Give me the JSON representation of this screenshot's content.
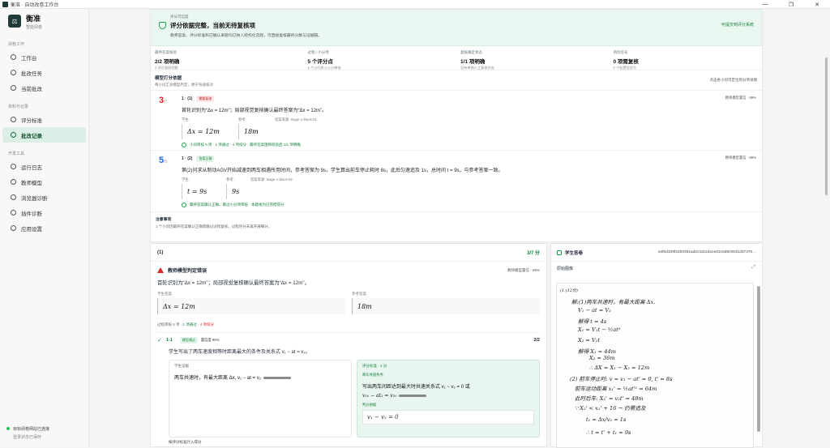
{
  "window": {
    "title": "衡准 · 自动改卷工作台",
    "min": "—",
    "max": "❐",
    "close": "✕"
  },
  "sidebar": {
    "brand_name": "衡准",
    "brand_sub": "智能阅卷",
    "groups": [
      {
        "label": "阅卷工作",
        "items": [
          "工作台",
          "批改任务",
          "当前批改"
        ]
      },
      {
        "label": "资料与记录",
        "items": [
          "评分标准",
          "批改记录"
        ]
      },
      {
        "label": "开发工具",
        "items": [
          "运行日志",
          "教师模型",
          "浏览器诊断",
          "插件诊断",
          "应用设置"
        ]
      }
    ],
    "active_item": "批改记录",
    "footer_status": "目标阅卷网站已连接",
    "footer_sub": "登录状态已保存"
  },
  "banner": {
    "tiny": "评分可信度",
    "title": "评分依据完整，当前无待复核项",
    "desc": "教师答案、评分标准和已确认单题均已纳入结构化流程，可直接复核最终分数与证据链。",
    "link": "可提交到评分系统"
  },
  "stats": [
    {
      "label": "最终答案核验",
      "value": "2/2 项明确",
      "desc": "2 项可直接判题"
    },
    {
      "label": "过程 / 小分项",
      "value": "5 个评分点",
      "desc": "1 个小问进入小分审核"
    },
    {
      "label": "复核确定状态",
      "value": "1/1 项明确",
      "desc": "没有单独人工复核任务"
    },
    {
      "label": "风险信号",
      "value": "0 项需复核",
      "desc": "0 个低置信信号"
    }
  ],
  "summary": {
    "title": "模型打分依据",
    "sub": "每小问汇总模型判定，便于快速核对",
    "right": "点击各小问可定位到分项详情"
  },
  "questions": [
    {
      "score": "3",
      "max": "/7",
      "id": "1 · (1)",
      "tag": "需要复核",
      "conf": "教师模型置信 · 99%",
      "text": "首轮识别为“Δx = 12m”；局部视觉复核确认最终答案为“Δx = 12m”。",
      "student_label": "学生:",
      "student": "Δx = 12m",
      "ref_label": "参考:",
      "ref": "18m",
      "source": "答案来源: triage-1-block-01",
      "foot": "小问审核 5 项 · 1 项通过 · 4 项扣分 · 最终答案阻断校验后 1/1 项明确"
    },
    {
      "score": "5",
      "max": "/5",
      "id": "1 · (2)",
      "tag": "答案正确",
      "conf": "教师模型置信 · 99%",
      "text": "第(2)问求从制动AGV开始减速到两车相遇所用时间，参考答案为 9s，学生算出前车停止耗时 8s，此后匀速追及 1s，总时间 t = 9s，与参考答案一致。",
      "student_label": "学生:",
      "student": "t = 9s",
      "ref_label": "参考:",
      "ref": "9s",
      "source": "答案来源: triage-1-block-02",
      "foot": "最终答案确认正确，跳过小分项审核 · 本题视为已完结得分"
    }
  ],
  "note": {
    "title": "注意事项",
    "text": "1 个小问因最终答案确认正确而跳过过程复核，过程评分未再开展细分。"
  },
  "detail": {
    "header": "(1)",
    "points": "3/7 分",
    "warn_title": "教师模型判定错误",
    "warn_conf": "教师模型置信 · 99%",
    "warn_text": "首轮识别为“Δx = 12m”；局部视觉复核确认最终答案为“Δx = 12m”。",
    "student_label": "学生答案",
    "student": "Δx = 12m",
    "ref_label": "参考答案",
    "ref": "18m",
    "steps": "过程审核 5 项",
    "steps_pass": "1 项通过",
    "steps_fail": "4 项扣分",
    "rubric_code": "1-1",
    "rubric_tag": "模型通过",
    "rubric_conf": "置信度 96%",
    "rubric_pts": "2/2",
    "rubric_text": "学生写出了两车速度相等时距离最大的条件及关系式 v₁ − at = v₂。",
    "left_label": "学生证据",
    "left_body": "两车共速时，有最大距离 Δx, v₁ − at = v₂",
    "right_label": "评分标准 · 2 分",
    "right_sub": "两车共速条件",
    "right_body": "写出两车间距达到最大时共速关系式 v₁ − v₂ = 0 或",
    "right_eq": "v₁₀ − at₁ = v₂₀",
    "right_sub2": "判分依据",
    "right_eq2": "v₁ − v₂ = 0",
    "footer": "按评分标准计入得分"
  },
  "paper": {
    "title": "学生答卷",
    "id": "34f0d109f24b0391ad2c4dc2da1e03c6d9c0531d37370…",
    "sub": "原始图像",
    "expand": "⤢",
    "lines": [
      "(1.(12分)",
      "解:(1)两车共速时，有最大距离 Δx.",
      "V₁ − at = V₂",
      "解得 t = 4s",
      "X₁ = V₁t − ½at²",
      "X₂ = V₂t",
      "解得 X₁ = 44m",
      "X₂ = 36m",
      "∴ ΔX = X₁ − X₂ = 12m",
      "(2) 前车停止时: v = v₁ − at' = 0, t' = 8s",
      "前车运动距离 x₁' = ½at'² = 64m",
      "此时后车: X₂' = v₂t' = 48m",
      "∵ X₂' < x₁' + 16 → 仍需追及",
      "t₁ = Δx/v₂ = 1s",
      "∴ t = t' + t₁ = 9s"
    ]
  }
}
